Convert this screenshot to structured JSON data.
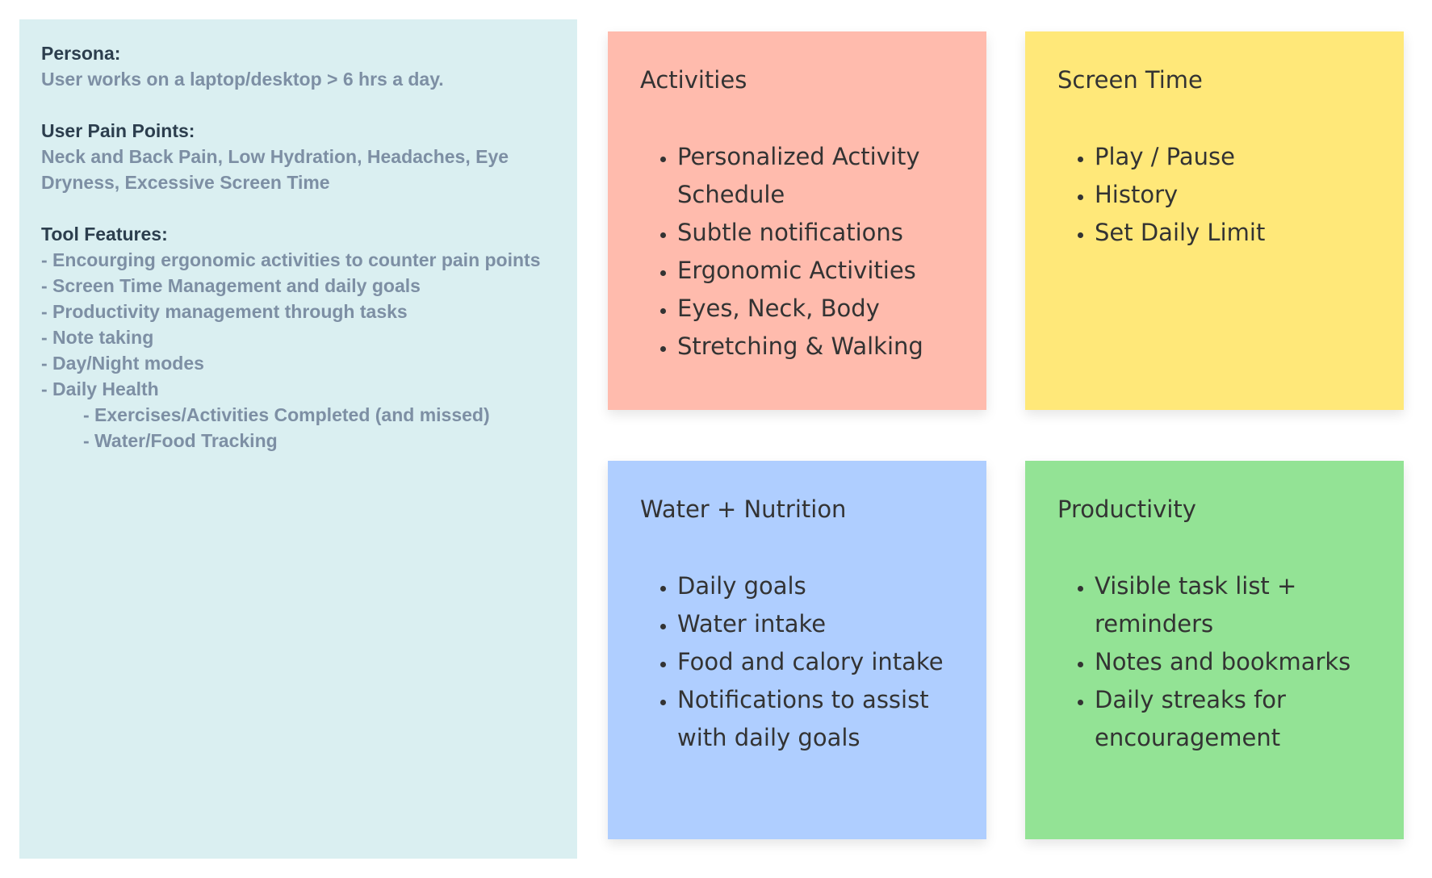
{
  "persona_panel": {
    "persona_heading": "Persona:",
    "persona_text": "User works on a laptop/desktop > 6 hrs a day.",
    "pain_heading": "User Pain Points:",
    "pain_text": "Neck and Back Pain, Low Hydration, Headaches, Eye Dryness, Excessive Screen Time",
    "features_heading": "Tool Features:",
    "features": [
      "- Encourging ergonomic activities to counter pain points",
      "- Screen Time Management and daily goals",
      "- Productivity management through tasks",
      "- Note taking",
      "- Day/Night modes",
      "- Daily Health"
    ],
    "daily_health_sub": [
      "- Exercises/Activities Completed (and missed)",
      "- Water/Food Tracking"
    ]
  },
  "notes": [
    {
      "title": "Activities",
      "color": "#FFBBAD",
      "items": [
        "Personalized Activity Schedule",
        "Subtle notifications",
        "Ergonomic Activities",
        "Eyes, Neck, Body",
        "Stretching & Walking"
      ]
    },
    {
      "title": "Screen Time",
      "color": "#FFE879",
      "items": [
        "Play / Pause",
        "History",
        "Set Daily Limit"
      ]
    },
    {
      "title": "Water + Nutrition",
      "color": "#AFCEFF",
      "items": [
        "Daily goals",
        "Water intake",
        "Food and calory intake",
        "Notifications to assist with daily goals"
      ]
    },
    {
      "title": "Productivity",
      "color": "#93E395",
      "items": [
        "Visible task list + reminders",
        "Notes and bookmarks",
        "Daily streaks for encouragement"
      ]
    }
  ]
}
